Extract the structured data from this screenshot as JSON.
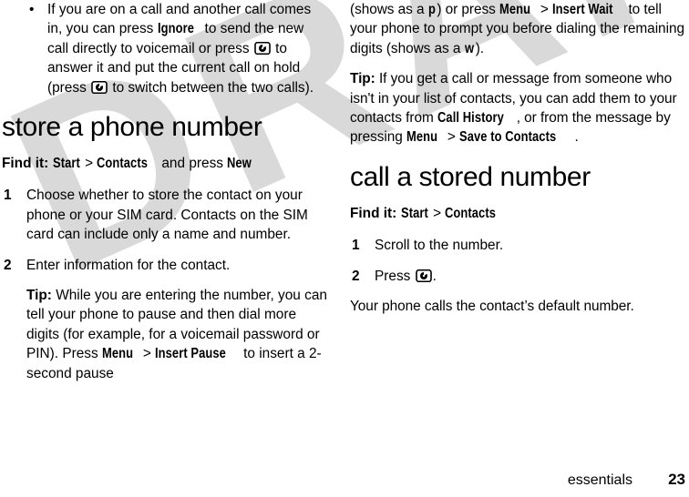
{
  "page": {
    "watermark_text": "DRAFT",
    "watermark_color": "#d9d9d9",
    "background_color": "#ffffff",
    "text_color": "#000000"
  },
  "footer": {
    "label": "essentials",
    "page_number": "23"
  },
  "icons": {
    "send_key": "send-key-icon",
    "bullet": "•"
  },
  "left_column": {
    "bullet_item": {
      "bullet": "•",
      "segments": [
        {
          "type": "text",
          "text": "If you are on a call and another call comes in, you can press "
        },
        {
          "type": "ui",
          "text": "Ignore"
        },
        {
          "type": "text",
          "text": " to send the new call directly to voicemail or press "
        },
        {
          "type": "icon",
          "text": "send-key-icon"
        },
        {
          "type": "text",
          "text": " to answer it and put the current call on hold (press "
        },
        {
          "type": "icon",
          "text": "send-key-icon"
        },
        {
          "type": "text",
          "text": " to switch between the two calls)."
        }
      ]
    },
    "heading": "store a phone number",
    "find_it": {
      "label": "Find it:",
      "path_1": "Start",
      "separator": ">",
      "path_2": "Contacts",
      "tail_text": " and press ",
      "path_3": "New"
    },
    "steps": [
      {
        "number": "1",
        "text": "Choose whether to store the contact on your phone or your SIM card. Contacts on the SIM card can include only a name and number."
      },
      {
        "number": "2",
        "text": "Enter information for the contact."
      }
    ],
    "tip": {
      "label": "Tip:",
      "segments": [
        {
          "type": "text",
          "text": " While you are entering the number, you can tell your phone to pause and then dial more digits (for example, for a voicemail password or PIN). Press "
        },
        {
          "type": "ui",
          "text": "Menu"
        },
        {
          "type": "text",
          "text": " > "
        },
        {
          "type": "ui",
          "text": "Insert Pause"
        },
        {
          "type": "text",
          "text": " to insert a 2-second pause"
        }
      ]
    }
  },
  "right_column": {
    "continuation": {
      "segments": [
        {
          "type": "text",
          "text": "(shows as a "
        },
        {
          "type": "ui",
          "text": "p"
        },
        {
          "type": "text",
          "text": ") or press "
        },
        {
          "type": "ui",
          "text": "Menu"
        },
        {
          "type": "text",
          "text": " > "
        },
        {
          "type": "ui",
          "text": "Insert Wait"
        },
        {
          "type": "text",
          "text": " to tell your phone to prompt you before dialing the remaining digits (shows as a "
        },
        {
          "type": "ui",
          "text": "w"
        },
        {
          "type": "text",
          "text": ")."
        }
      ]
    },
    "tip": {
      "label": "Tip:",
      "segments": [
        {
          "type": "text",
          "text": " If you get a call or message from someone who isn't in your list of contacts, you can add them to your contacts from "
        },
        {
          "type": "ui",
          "text": "Call History"
        },
        {
          "type": "text",
          "text": ", or from the message by pressing "
        },
        {
          "type": "ui",
          "text": "Menu"
        },
        {
          "type": "text",
          "text": " > "
        },
        {
          "type": "ui",
          "text": "Save to Contacts"
        },
        {
          "type": "text",
          "text": "."
        }
      ]
    },
    "heading": "call a stored number",
    "find_it": {
      "label": "Find it:",
      "path_1": "Start",
      "separator": ">",
      "path_2": "Contacts"
    },
    "steps": [
      {
        "number": "1",
        "text": "Scroll to the number."
      },
      {
        "number": "2",
        "text_before": "Press ",
        "icon": "send-key-icon",
        "text_after": "."
      }
    ],
    "closing": "Your phone calls the contact’s default number."
  }
}
